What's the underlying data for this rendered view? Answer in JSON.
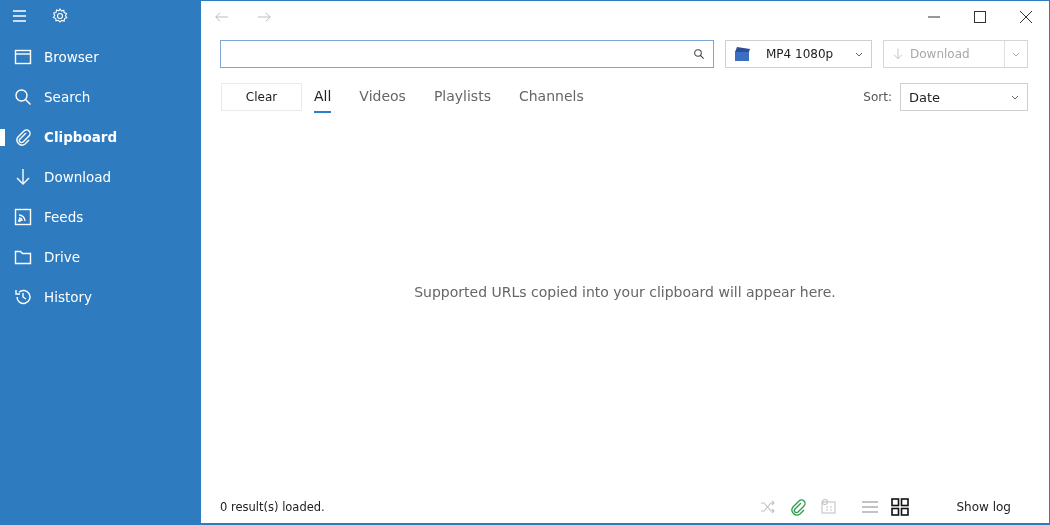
{
  "sidebar": {
    "items": [
      {
        "label": "Browser",
        "kind": "browser",
        "selected": false
      },
      {
        "label": "Search",
        "kind": "search",
        "selected": false
      },
      {
        "label": "Clipboard",
        "kind": "clip",
        "selected": true
      },
      {
        "label": "Download",
        "kind": "download",
        "selected": false
      },
      {
        "label": "Feeds",
        "kind": "feed",
        "selected": false
      },
      {
        "label": "Drive",
        "kind": "folder",
        "selected": false
      },
      {
        "label": "History",
        "kind": "history",
        "selected": false
      }
    ]
  },
  "toolbar": {
    "format": "MP4 1080p",
    "download": {
      "label": "Download",
      "disabled": true
    }
  },
  "filter": {
    "clear": "Clear",
    "tabs": [
      {
        "label": "All",
        "selected": true
      },
      {
        "label": "Videos",
        "selected": false
      },
      {
        "label": "Playlists",
        "selected": false
      },
      {
        "label": "Channels",
        "selected": false
      }
    ],
    "sort_label": "Sort:",
    "sort_value": "Date"
  },
  "empty_message": "Supported URLs copied into your clipboard will appear here.",
  "status_bar": {
    "text": "0 result(s) loaded.",
    "toggles": [
      {
        "kind": "shuffle",
        "on": false
      },
      {
        "kind": "clip",
        "on": true
      },
      {
        "kind": "calendar",
        "on": false
      }
    ],
    "views": [
      {
        "kind": "list",
        "selected": false
      },
      {
        "kind": "grid",
        "selected": true
      }
    ],
    "show_log": "Show log"
  }
}
